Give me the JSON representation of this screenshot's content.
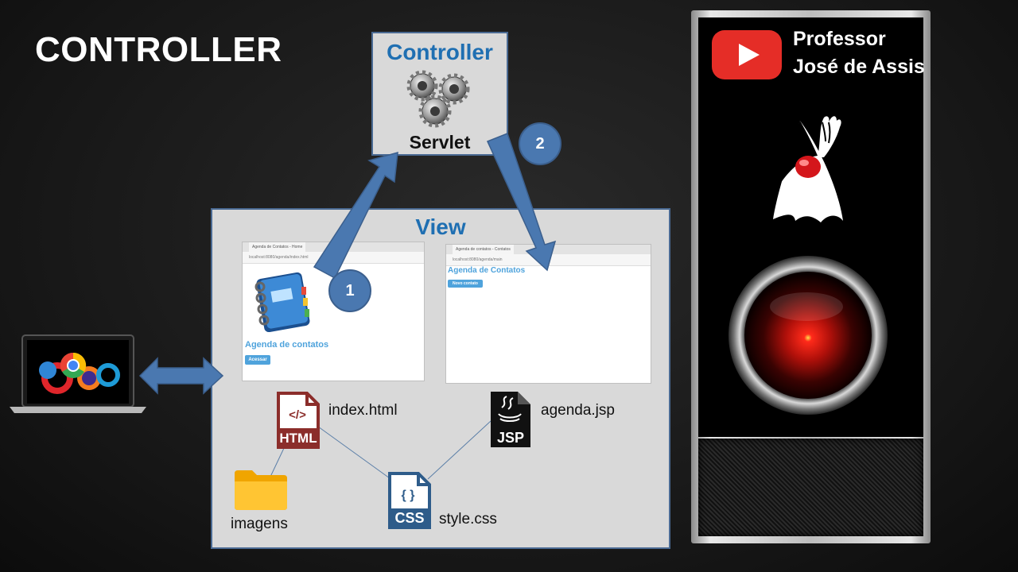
{
  "title": "CONTROLLER",
  "controller": {
    "title": "Controller",
    "component": "Servlet"
  },
  "view": {
    "title": "View",
    "index_browser": {
      "tab": "Agenda de Contatos - Home",
      "url": "localhost:8080/agenda/index.html",
      "heading": "Agenda de contatos",
      "button": "Acessar"
    },
    "agenda_browser": {
      "tab": "Agenda de contatos - Contatos",
      "url": "localhost:8080/agenda/main",
      "heading": "Agenda de Contatos",
      "button": "Novo contato"
    },
    "files": {
      "index": "index.html",
      "agenda": "agenda.jsp",
      "style": "style.css",
      "imagens": "imagens"
    },
    "file_icons": {
      "html": "HTML",
      "jsp": "JSP",
      "css": "CSS",
      "html_glyph": "</>",
      "css_glyph": "{ }"
    }
  },
  "steps": {
    "one": "1",
    "two": "2"
  },
  "channel": {
    "line1": "Professor",
    "line2": "José de Assis"
  },
  "colors": {
    "accent_blue": "#1f6fb2",
    "arrow_blue": "#4a78b0",
    "box_gray": "#d9d9d9",
    "html_red": "#8b2d2a",
    "css_blue": "#2e5c8a",
    "youtube_red": "#e52d27",
    "hal_red": "#ff2a1a"
  }
}
